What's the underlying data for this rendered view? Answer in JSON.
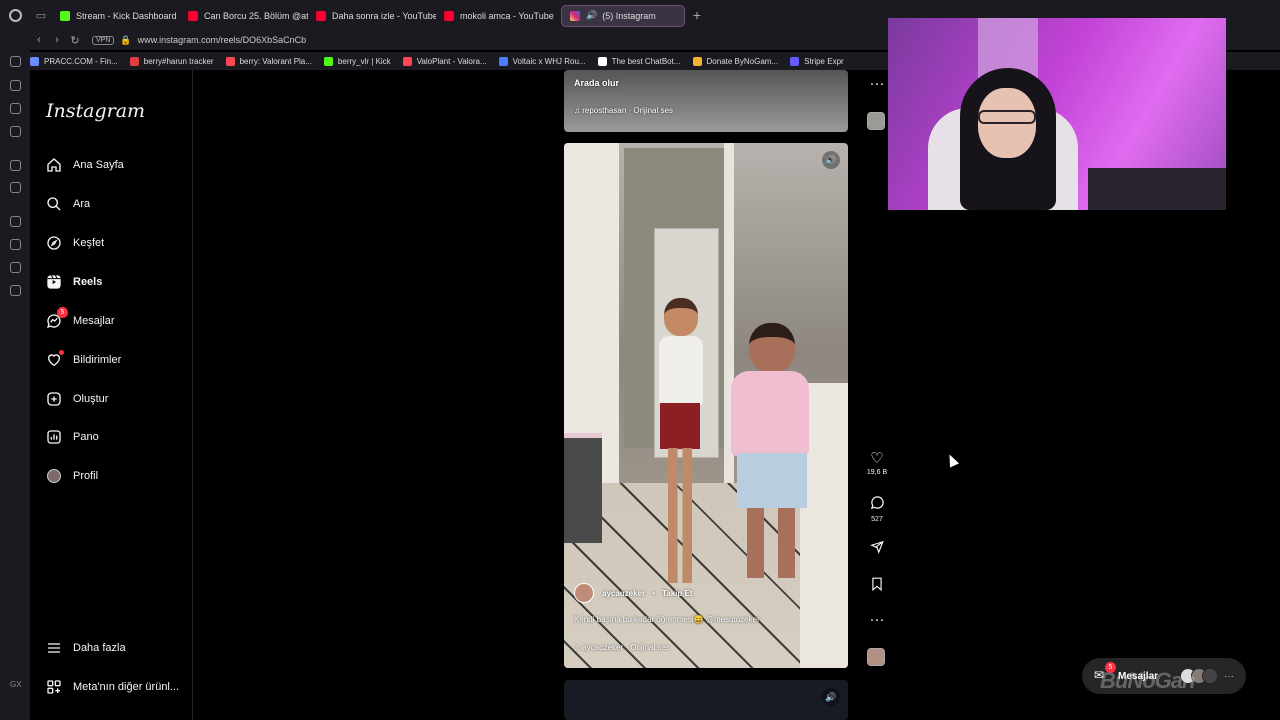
{
  "browser": {
    "tabs": [
      {
        "title": "Stream - Kick Dashboard",
        "color": "#53fc18"
      },
      {
        "title": "Can Borcu 25. Bölüm @at",
        "color": "#ff0033"
      },
      {
        "title": "Daha sonra izle - YouTube",
        "color": "#ff0033"
      },
      {
        "title": "mokoli amca - YouTube",
        "color": "#ff0033"
      },
      {
        "title": "(5) Instagram",
        "color": "#d62976",
        "active": true
      }
    ],
    "url": "www.instagram.com/reels/DO6XbSaCnCb",
    "vpn": "VPN",
    "bookmarks": [
      {
        "label": "PRACC.COM - Fin...",
        "color": "#6a8cff"
      },
      {
        "label": "berry#harun tracker",
        "color": "#e04040"
      },
      {
        "label": "berry: Valorant Pla...",
        "color": "#ff4655"
      },
      {
        "label": "berry_vlr | Kick",
        "color": "#53fc18"
      },
      {
        "label": "ValoPlant - Valora...",
        "color": "#ff4655"
      },
      {
        "label": "Voltaic x WHJ Rou...",
        "color": "#4a7dff"
      },
      {
        "label": "The best ChatBot...",
        "color": "#ffffff"
      },
      {
        "label": "Donate ByNoGam...",
        "color": "#f2b233"
      },
      {
        "label": "Stripe Expr",
        "color": "#635bff"
      }
    ]
  },
  "instagram": {
    "logo": "Instagram",
    "nav": [
      {
        "label": "Ana Sayfa",
        "icon": "home-icon"
      },
      {
        "label": "Ara",
        "icon": "search-icon"
      },
      {
        "label": "Keşfet",
        "icon": "compass-icon"
      },
      {
        "label": "Reels",
        "icon": "reels-icon",
        "active": true
      },
      {
        "label": "Mesajlar",
        "icon": "messenger-icon",
        "badge": "5"
      },
      {
        "label": "Bildirimler",
        "icon": "heart-icon"
      },
      {
        "label": "Oluştur",
        "icon": "plus-square-icon"
      },
      {
        "label": "Pano",
        "icon": "dashboard-icon"
      },
      {
        "label": "Profil",
        "icon": "avatar-icon"
      }
    ],
    "more": "Daha fazla",
    "meta": "Meta'nın diğer ürünl..."
  },
  "reel_prev": {
    "caption": "Arada olur",
    "audio": "reposthasan · Orijinal ses"
  },
  "reel_main": {
    "author": "aycaozeker",
    "follow": "Takip Et",
    "caption": "Kendi başına bu kadar öğrenmesi😄 @mesutozeker",
    "audio": "aycaozeker · Orijinal ses",
    "likes": "19,6 B",
    "comments": "527"
  },
  "messages_pill": {
    "label": "Mesajlar",
    "badge": "5"
  },
  "watermark": "BuNoGan",
  "colors": {
    "badge": "#ff3040",
    "bg": "#000000",
    "text": "#f5f5f5"
  }
}
